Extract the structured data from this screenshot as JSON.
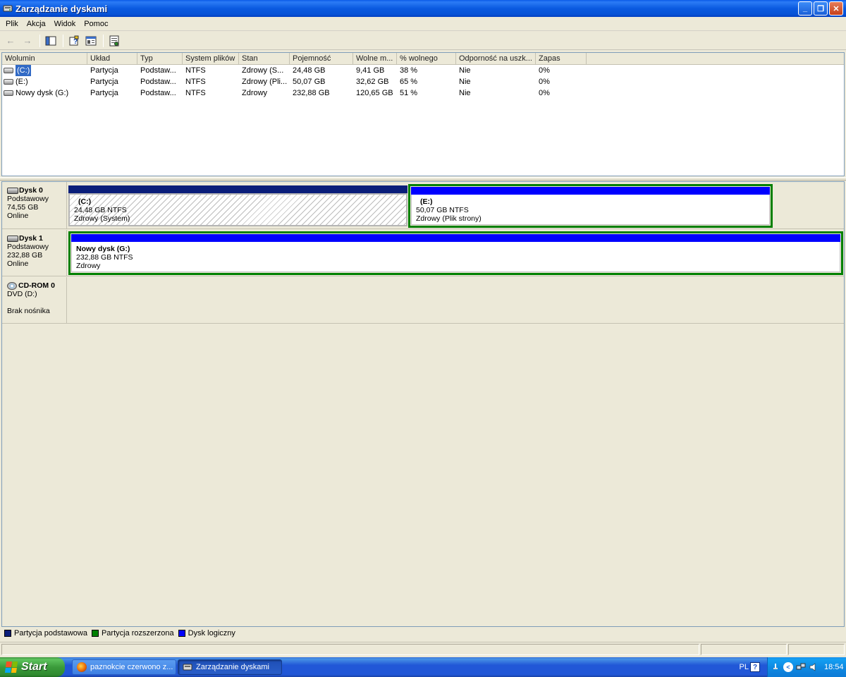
{
  "window": {
    "title": "Zarządzanie dyskami",
    "minimize": "_",
    "restore": "❐",
    "close": "✕"
  },
  "menu": [
    "Plik",
    "Akcja",
    "Widok",
    "Pomoc"
  ],
  "toolbar": {
    "back": "←",
    "forward": "→"
  },
  "volume_table": {
    "columns": [
      "Wolumin",
      "Układ",
      "Typ",
      "System plików",
      "Stan",
      "Pojemność",
      "Wolne m...",
      "% wolnego",
      "Odporność na uszk...",
      "Zapas"
    ],
    "rows": [
      [
        "(C:)",
        "Partycja",
        "Podstaw...",
        "NTFS",
        "Zdrowy (S...",
        "24,48 GB",
        "9,41 GB",
        "38 %",
        "Nie",
        "0%"
      ],
      [
        "(E:)",
        "Partycja",
        "Podstaw...",
        "NTFS",
        "Zdrowy (Pli...",
        "50,07 GB",
        "32,62 GB",
        "65 %",
        "Nie",
        "0%"
      ],
      [
        "Nowy dysk (G:)",
        "Partycja",
        "Podstaw...",
        "NTFS",
        "Zdrowy",
        "232,88 GB",
        "120,65 GB",
        "51 %",
        "Nie",
        "0%"
      ]
    ]
  },
  "disks": [
    {
      "name": "Dysk 0",
      "type": "Podstawowy",
      "size": "74,55 GB",
      "status": "Online",
      "partitions": [
        {
          "name": "(C:)",
          "size": "24,48 GB NTFS",
          "status": "Zdrowy (System)"
        },
        {
          "name": "(E:)",
          "size": "50,07 GB NTFS",
          "status": "Zdrowy (Plik strony)"
        }
      ]
    },
    {
      "name": "Dysk 1",
      "type": "Podstawowy",
      "size": "232,88 GB",
      "status": "Online",
      "partitions": [
        {
          "name": "Nowy dysk  (G:)",
          "size": "232,88 GB NTFS",
          "status": "Zdrowy"
        }
      ]
    },
    {
      "name": "CD-ROM 0",
      "type": "DVD (D:)",
      "size": "",
      "status": "Brak nośnika"
    }
  ],
  "legend": [
    {
      "label": "Partycja podstawowa",
      "color": "#0a1e7a"
    },
    {
      "label": "Partycja rozszerzona",
      "color": "#008000"
    },
    {
      "label": "Dysk logiczny",
      "color": "#0000ff"
    }
  ],
  "taskbar": {
    "start": "Start",
    "tasks": [
      "paznokcie czerwono z...",
      "Zarządzanie dyskami"
    ],
    "language": "PL",
    "help": "?",
    "clock": "18:54"
  }
}
